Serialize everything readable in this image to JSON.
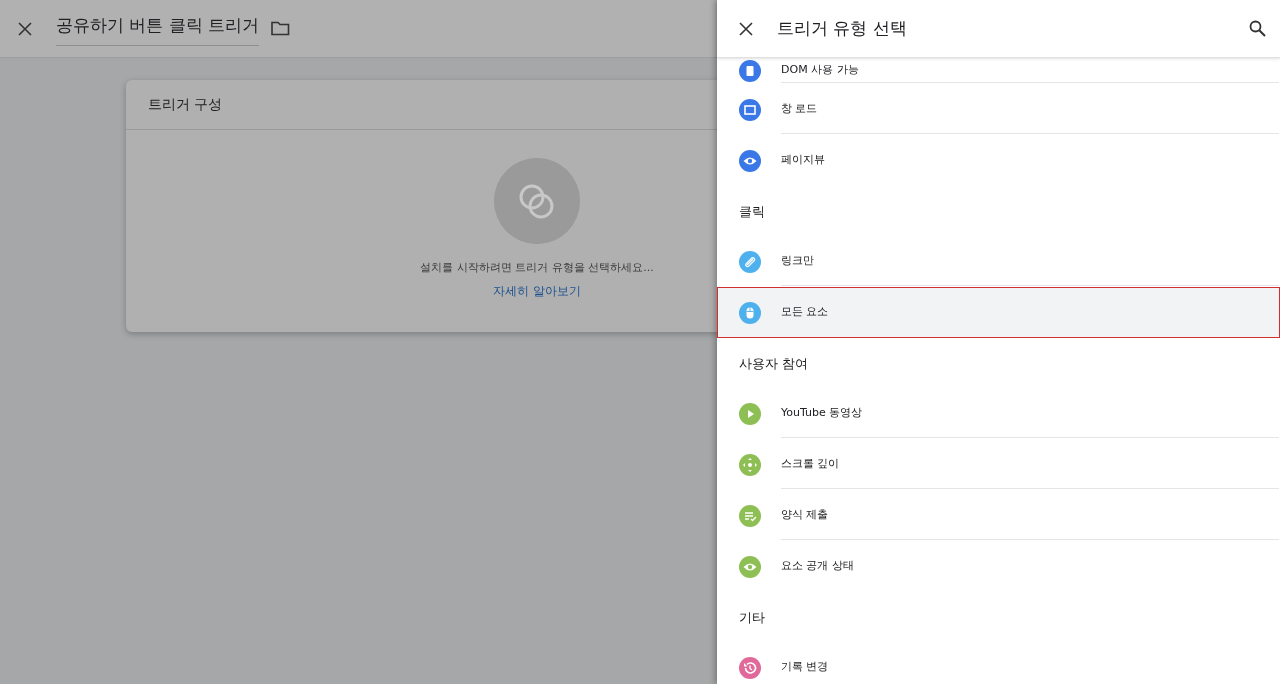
{
  "editor": {
    "title": "공유하기 버튼 클릭 트리거"
  },
  "trigger_card": {
    "title": "트리거 구성",
    "prompt": "설치를 시작하려면 트리거 유형을 선택하세요...",
    "link": "자세히 알아보기"
  },
  "drawer": {
    "title": "트리거 유형 선택",
    "groups": [
      {
        "items": [
          {
            "label": "DOM 사용 가능",
            "kind": "document",
            "color": "#3b78e7",
            "selected": false
          },
          {
            "label": "창 로드",
            "kind": "window",
            "color": "#3b78e7",
            "selected": false
          },
          {
            "label": "페이지뷰",
            "kind": "eye",
            "color": "#3b78e7",
            "selected": false
          }
        ]
      },
      {
        "heading": "클릭",
        "items": [
          {
            "label": "링크만",
            "kind": "link",
            "color": "#4fb0ee",
            "selected": false
          },
          {
            "label": "모든 요소",
            "kind": "mouse",
            "color": "#4fb0ee",
            "selected": true
          }
        ]
      },
      {
        "heading": "사용자 참여",
        "items": [
          {
            "label": "YouTube 동영상",
            "kind": "play",
            "color": "#8dbf55",
            "selected": false
          },
          {
            "label": "스크롤 깊이",
            "kind": "move",
            "color": "#8dbf55",
            "selected": false
          },
          {
            "label": "양식 제출",
            "kind": "form",
            "color": "#8dbf55",
            "selected": false
          },
          {
            "label": "요소 공개 상태",
            "kind": "eye",
            "color": "#8dbf55",
            "selected": false
          }
        ]
      },
      {
        "heading": "기타",
        "items": [
          {
            "label": "기록 변경",
            "kind": "history",
            "color": "#e0699a",
            "selected": false
          }
        ]
      }
    ]
  }
}
